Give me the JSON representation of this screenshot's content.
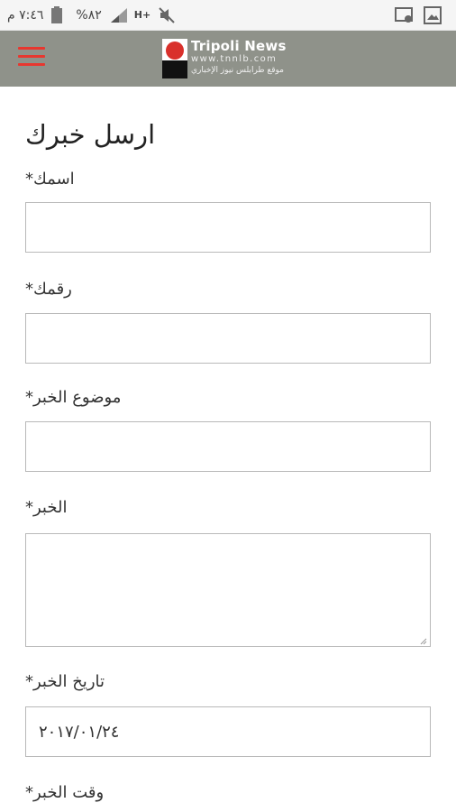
{
  "status_bar": {
    "time": "٧:٤٦ م",
    "battery": "%٨٢",
    "network": "H+"
  },
  "header": {
    "logo_title": "Tripoli News",
    "logo_url": "www.tnnlb.com",
    "logo_tagline": "موقع طرابلس نيوز الإخباري"
  },
  "form": {
    "title": "ارسل خبرك",
    "fields": [
      {
        "label": "اسمك*",
        "value": ""
      },
      {
        "label": "رقمك*",
        "value": ""
      },
      {
        "label": "موضوع الخبر*",
        "value": ""
      },
      {
        "label": "الخبر*",
        "value": ""
      },
      {
        "label": "تاريخ الخبر*",
        "value": "٢٠١٧/٠١/٢٤"
      },
      {
        "label": "وقت الخبر*",
        "value": ""
      }
    ]
  }
}
